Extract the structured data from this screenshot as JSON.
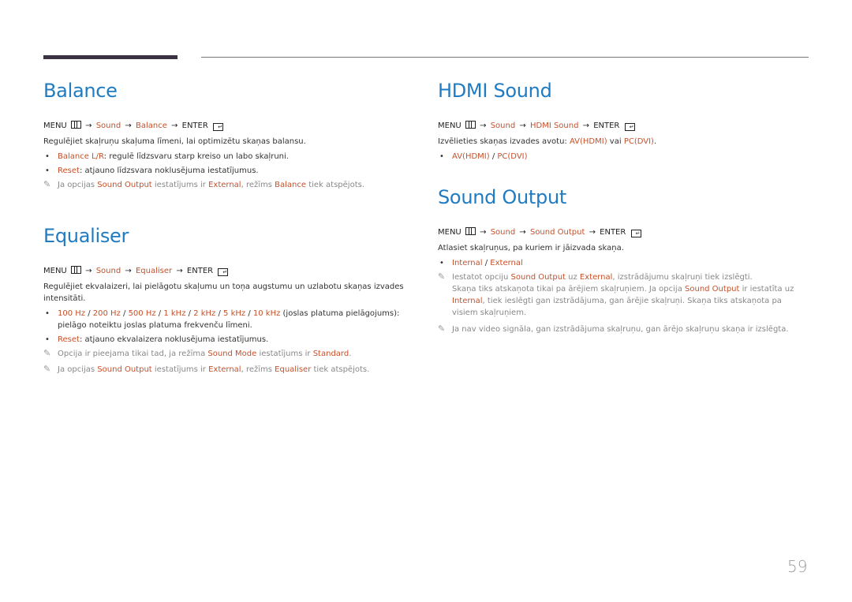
{
  "page_number": "59",
  "sections": {
    "balance": {
      "title": "Balance",
      "menu": {
        "menu": "MENU",
        "arrow": "→",
        "sound": "Sound",
        "item": "Balance",
        "enter": "ENTER"
      },
      "description": "Regulējiet skaļruņu skaļuma līmeni, lai optimizētu skaņas balansu.",
      "bullets": [
        {
          "label": "Balance L/R",
          "text": ": regulē līdzsvaru starp kreiso un labo skaļruni."
        },
        {
          "label": "Reset",
          "text": ": atjauno līdzsvara noklusējuma iestatījumus."
        }
      ],
      "note": {
        "t1": "Ja opcijas ",
        "h1": "Sound Output",
        "t2": " iestatījums ir ",
        "h2": "External",
        "t3": ", režīms ",
        "h3": "Balance",
        "t4": " tiek atspējots."
      }
    },
    "equaliser": {
      "title": "Equaliser",
      "menu": {
        "menu": "MENU",
        "arrow": "→",
        "sound": "Sound",
        "item": "Equaliser",
        "enter": "ENTER"
      },
      "description": "Regulējiet ekvalaizeri, lai pielāgotu skaļumu un toņa augstumu un uzlabotu skaņas izvades intensitāti.",
      "bands": [
        "100 Hz",
        "200 Hz",
        "500 Hz",
        "1 kHz",
        "2 kHz",
        "5 kHz",
        "10 kHz"
      ],
      "band_sep": " / ",
      "band_text": " (joslas platuma pielāgojums): pielāgo noteiktu joslas platuma frekvenču līmeni.",
      "reset": {
        "label": "Reset",
        "text": ": atjauno ekvalaizera noklusējuma iestatījumus."
      },
      "note1": {
        "t1": "Opcija ir pieejama tikai tad, ja režīma ",
        "h1": "Sound Mode",
        "t2": " iestatījums ir ",
        "h2": "Standard",
        "t3": "."
      },
      "note2": {
        "t1": "Ja opcijas ",
        "h1": "Sound Output",
        "t2": " iestatījums ir ",
        "h2": "External",
        "t3": ", režīms ",
        "h3": "Equaliser",
        "t4": " tiek atspējots."
      }
    },
    "hdmi_sound": {
      "title": "HDMI Sound",
      "menu": {
        "menu": "MENU",
        "arrow": "→",
        "sound": "Sound",
        "item": "HDMI Sound",
        "enter": "ENTER"
      },
      "description": {
        "t1": "Izvēlieties skaņas izvades avotu: ",
        "h1": "AV(HDMI)",
        "t2": " vai ",
        "h2": "PC(DVI)",
        "t3": "."
      },
      "options": [
        "AV(HDMI)",
        "PC(DVI)"
      ],
      "sep": " / "
    },
    "sound_output": {
      "title": "Sound Output",
      "menu": {
        "menu": "MENU",
        "arrow": "→",
        "sound": "Sound",
        "item": "Sound Output",
        "enter": "ENTER"
      },
      "description": "Atlasiet skaļruņus, pa kuriem ir jāizvada skaņa.",
      "options": [
        "Internal",
        "External"
      ],
      "sep": " / ",
      "note1": {
        "t1": "Iestatot opciju ",
        "h1": "Sound Output",
        "t2": " uz ",
        "h2": "External",
        "t3": ", izstrādājumu skaļruņi tiek izslēgti.",
        "c1": "Skaņa tiks atskaņota tikai pa ārējiem skaļruņiem. Ja opcija ",
        "ch1": "Sound Output",
        "c2": " ir iestatīta uz ",
        "ch2": "Internal",
        "c3": ", tiek ieslēgti gan izstrādājuma, gan ārējie skaļruņi. Skaņa tiks atskaņota pa visiem skaļruņiem."
      },
      "note2": "Ja nav video signāla, gan izstrādājuma skaļruņu, gan ārējo skaļruņu skaņa ir izslēgta."
    }
  }
}
